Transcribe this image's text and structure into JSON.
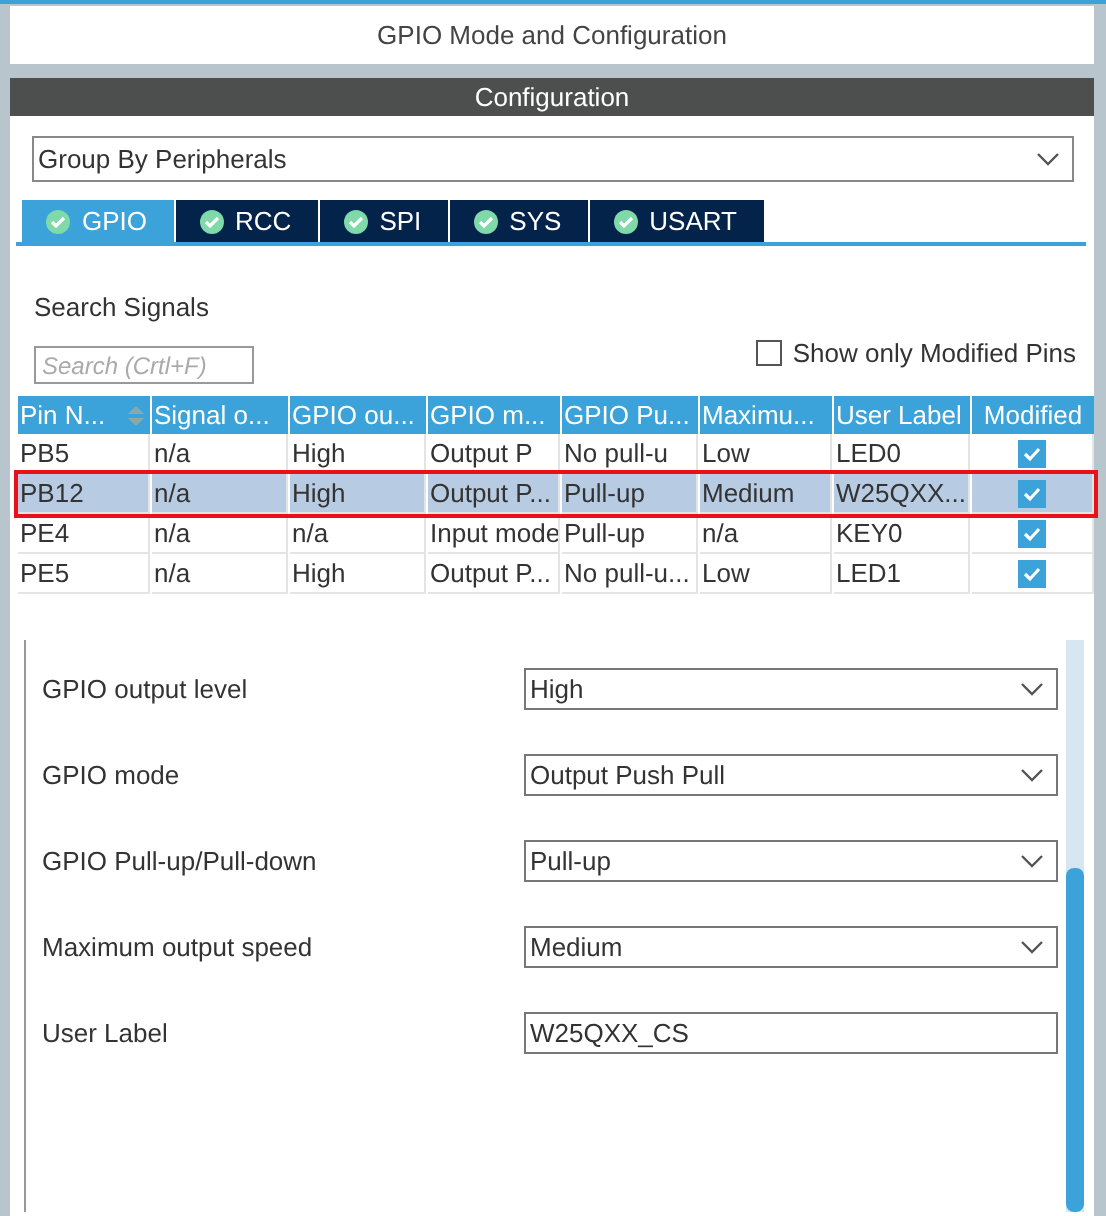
{
  "window": {
    "title": "GPIO Mode and Configuration"
  },
  "section_title": "Configuration",
  "group_by": {
    "value": "Group By Peripherals"
  },
  "tabs": [
    {
      "label": "GPIO",
      "selected": true
    },
    {
      "label": "RCC",
      "selected": false
    },
    {
      "label": "SPI",
      "selected": false
    },
    {
      "label": "SYS",
      "selected": false
    },
    {
      "label": "USART",
      "selected": false
    }
  ],
  "search": {
    "label": "Search Signals",
    "placeholder": "Search (Crtl+F)"
  },
  "show_only_modified": {
    "label": "Show only Modified Pins",
    "checked": false
  },
  "table": {
    "columns": [
      "Pin N...",
      "Signal o...",
      "GPIO ou...",
      "GPIO m...",
      "GPIO Pu...",
      "Maximu...",
      "User Label",
      "Modified"
    ],
    "rows": [
      {
        "cells": [
          "PB5",
          "n/a",
          "High",
          "Output P",
          "No pull-u",
          "Low",
          "LED0"
        ],
        "modified": true,
        "selected": false
      },
      {
        "cells": [
          "PB12",
          "n/a",
          "High",
          "Output P...",
          "Pull-up",
          "Medium",
          "W25QXX..."
        ],
        "modified": true,
        "selected": true
      },
      {
        "cells": [
          "PE4",
          "n/a",
          "n/a",
          "Input mode",
          "Pull-up",
          "n/a",
          "KEY0"
        ],
        "modified": true,
        "selected": false
      },
      {
        "cells": [
          "PE5",
          "n/a",
          "High",
          "Output P...",
          "No pull-u...",
          "Low",
          "LED1"
        ],
        "modified": true,
        "selected": false
      }
    ]
  },
  "settings": [
    {
      "label": "GPIO output level",
      "value": "High",
      "kind": "dropdown"
    },
    {
      "label": "GPIO mode",
      "value": "Output Push Pull",
      "kind": "dropdown"
    },
    {
      "label": "GPIO Pull-up/Pull-down",
      "value": "Pull-up",
      "kind": "dropdown"
    },
    {
      "label": "Maximum output speed",
      "value": "Medium",
      "kind": "dropdown"
    },
    {
      "label": "User Label",
      "value": "W25QXX_CS",
      "kind": "text"
    }
  ]
}
